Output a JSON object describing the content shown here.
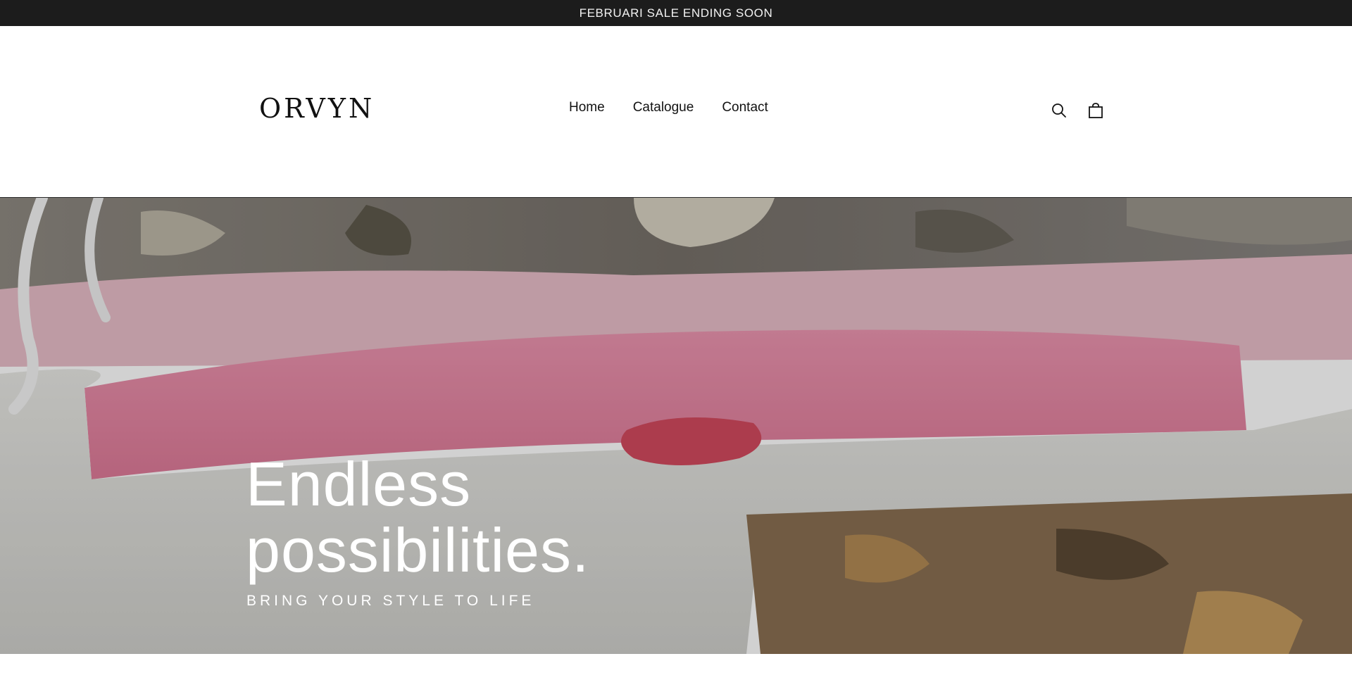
{
  "announcement": {
    "text": "FEBRUARI SALE ENDING SOON"
  },
  "header": {
    "logo": "ORVYN",
    "nav": [
      {
        "label": "Home"
      },
      {
        "label": "Catalogue"
      },
      {
        "label": "Contact"
      }
    ],
    "icons": {
      "search": "search-icon",
      "cart": "bag-icon"
    }
  },
  "hero": {
    "title_line1": "Endless",
    "title_line2": "possibilities.",
    "subtitle": "BRING YOUR STYLE TO LIFE"
  },
  "colors": {
    "announcement_bg": "#1c1c1c",
    "text_dark": "#121212",
    "hero_text": "#ffffff",
    "pink": "#e98aa6",
    "light_pink": "#e9c1cb",
    "white_fabric": "#e6e6e3",
    "camo_brown": "#7d6649"
  }
}
